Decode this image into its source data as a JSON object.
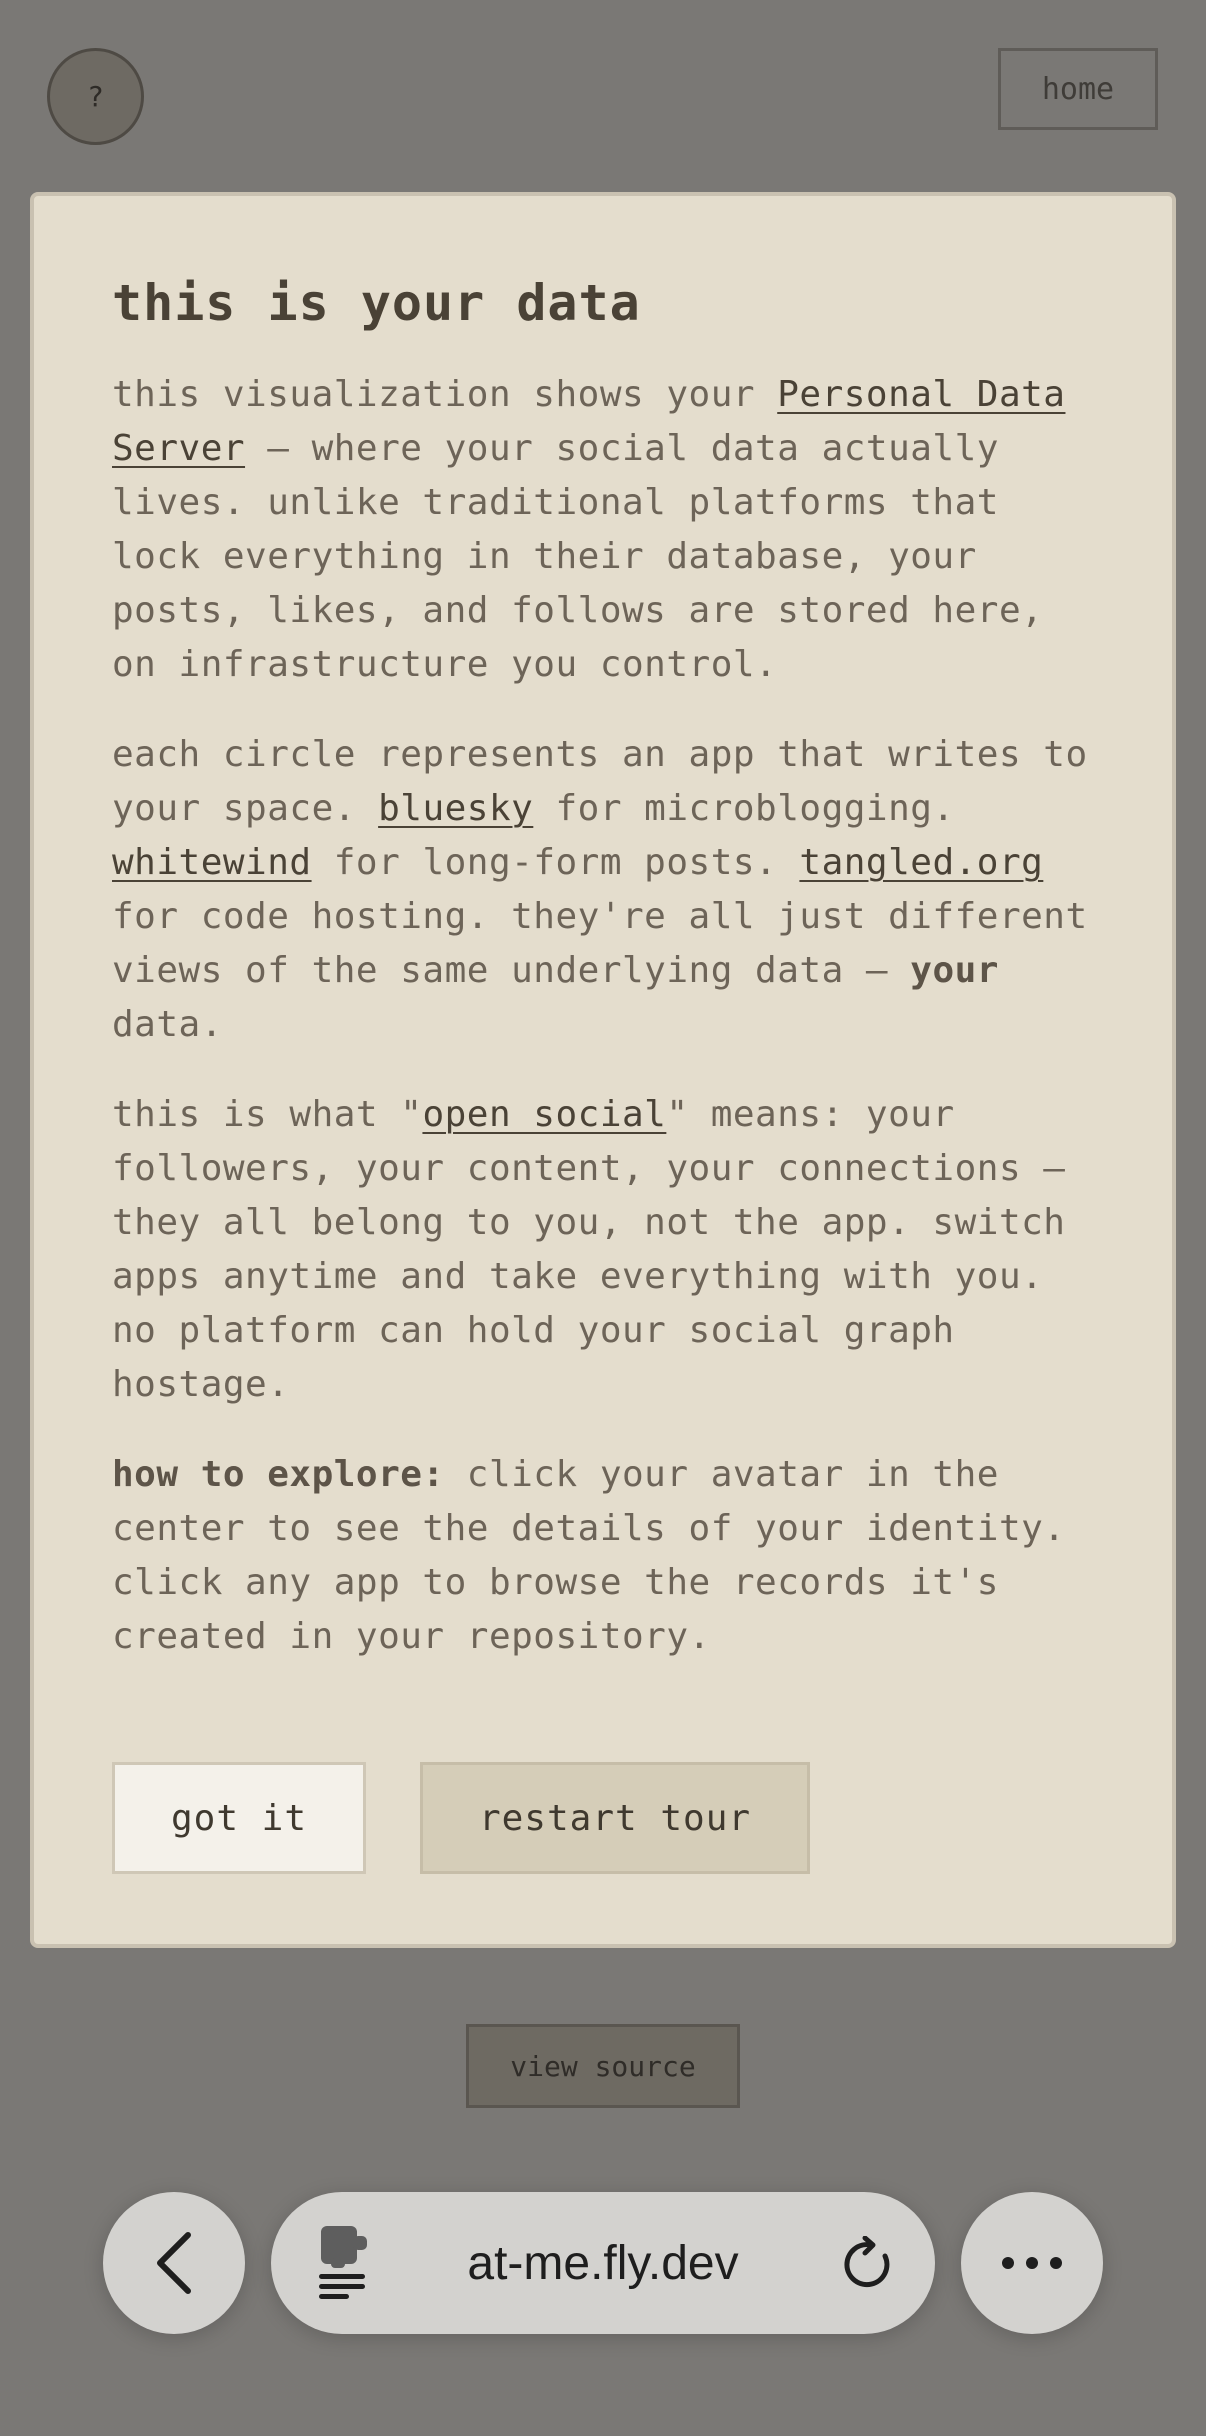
{
  "topbar": {
    "help_label": "?",
    "home_label": "home"
  },
  "modal": {
    "title": "this is your data",
    "p1": {
      "t1": "this visualization shows your ",
      "link1": "Personal Data Server",
      "t2": " — where your social data actually lives. unlike traditional platforms that lock everything in their database, your posts, likes, and follows are stored here, on infrastructure you control."
    },
    "p2": {
      "t1": "each circle represents an app that writes to your space. ",
      "link_bluesky": "bluesky",
      "t2": " for microblogging. ",
      "link_whitewind": "whitewind",
      "t3": " for long-form posts. ",
      "link_tangled": "tangled.org",
      "t4": " for code hosting. they're all just different views of the same underlying data — ",
      "bold": "your",
      "t5": " data."
    },
    "p3": {
      "t1": "this is what \"",
      "link": "open social",
      "t2": "\" means: your followers, your content, your connections — they all belong to you, not the app. switch apps anytime and take everything with you. no platform can hold your social graph hostage."
    },
    "p4": {
      "bold": "how to explore:",
      "t1": " click your avatar in the center to see the details of your identity. click any app to browse the records it's created in your repository."
    },
    "buttons": {
      "got_it": "got it",
      "restart_tour": "restart tour"
    }
  },
  "footer": {
    "view_source": "view source"
  },
  "browser": {
    "url": "at-me.fly.dev",
    "icons": [
      "back-chevron-icon",
      "extension-icon",
      "reload-icon",
      "more-icon"
    ]
  }
}
